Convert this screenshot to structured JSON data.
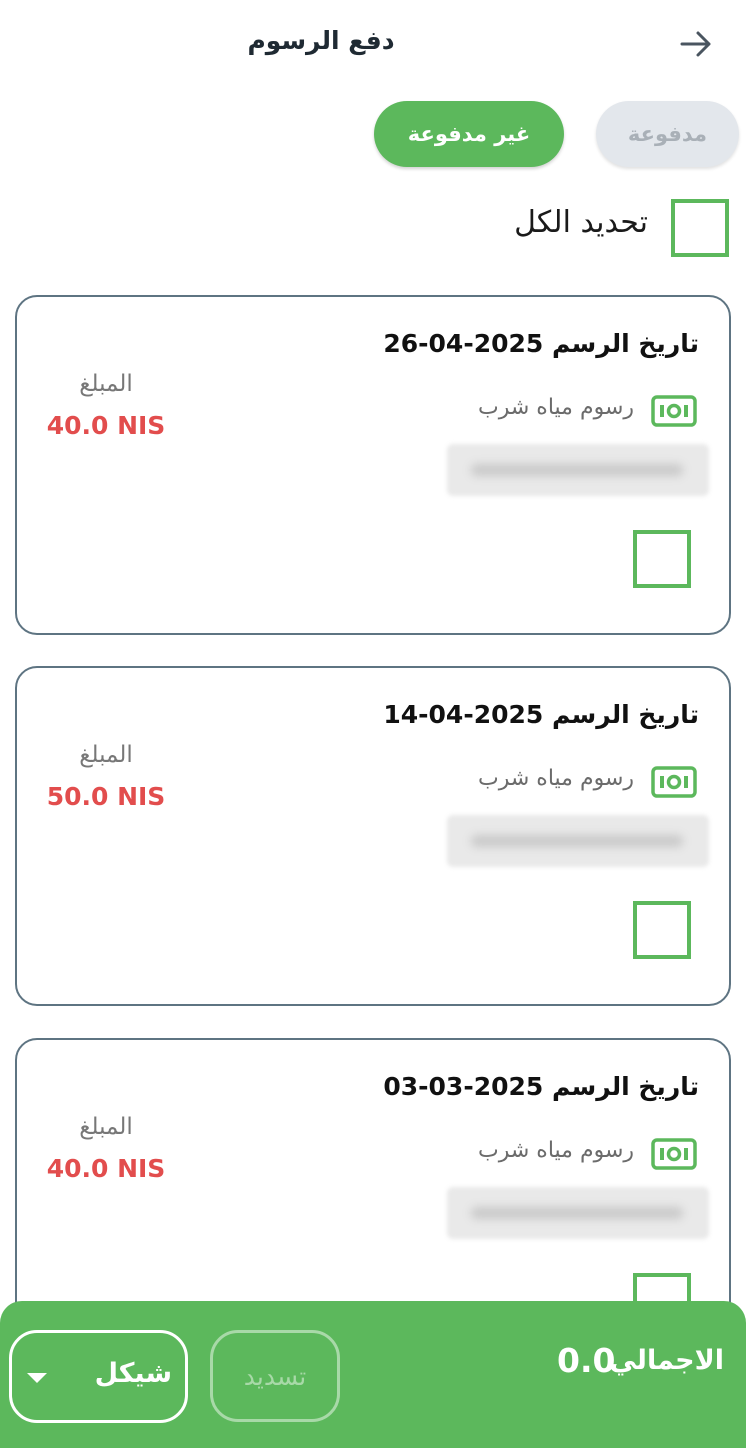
{
  "header": {
    "title": "دفع الرسوم",
    "back_icon": "arrow-right-icon"
  },
  "tabs": {
    "unpaid_label": "غير مدفوعة",
    "paid_label": "مدفوعة",
    "active": "unpaid"
  },
  "select_all": {
    "label": "تحديد الكل",
    "checked": false
  },
  "fees": [
    {
      "date": "تاريخ الرسم 2025-04-26",
      "type": "رسوم مياه شرب",
      "amount_label": "المبلغ",
      "amount": "40.0 NIS",
      "checked": false
    },
    {
      "date": "تاريخ الرسم 2025-04-14",
      "type": "رسوم مياه شرب",
      "amount_label": "المبلغ",
      "amount": "50.0 NIS",
      "checked": false
    },
    {
      "date": "تاريخ الرسم 2025-03-03",
      "type": "رسوم مياه شرب",
      "amount_label": "المبلغ",
      "amount": "40.0 NIS",
      "checked": false
    }
  ],
  "footer": {
    "total_label": "الاجمالي",
    "total_value": "0.0",
    "pay_label": "تسديد",
    "currency": "شيكل"
  },
  "colors": {
    "accent": "#5cb85c",
    "amount": "#e24d4d",
    "card_border": "#5e7482"
  }
}
